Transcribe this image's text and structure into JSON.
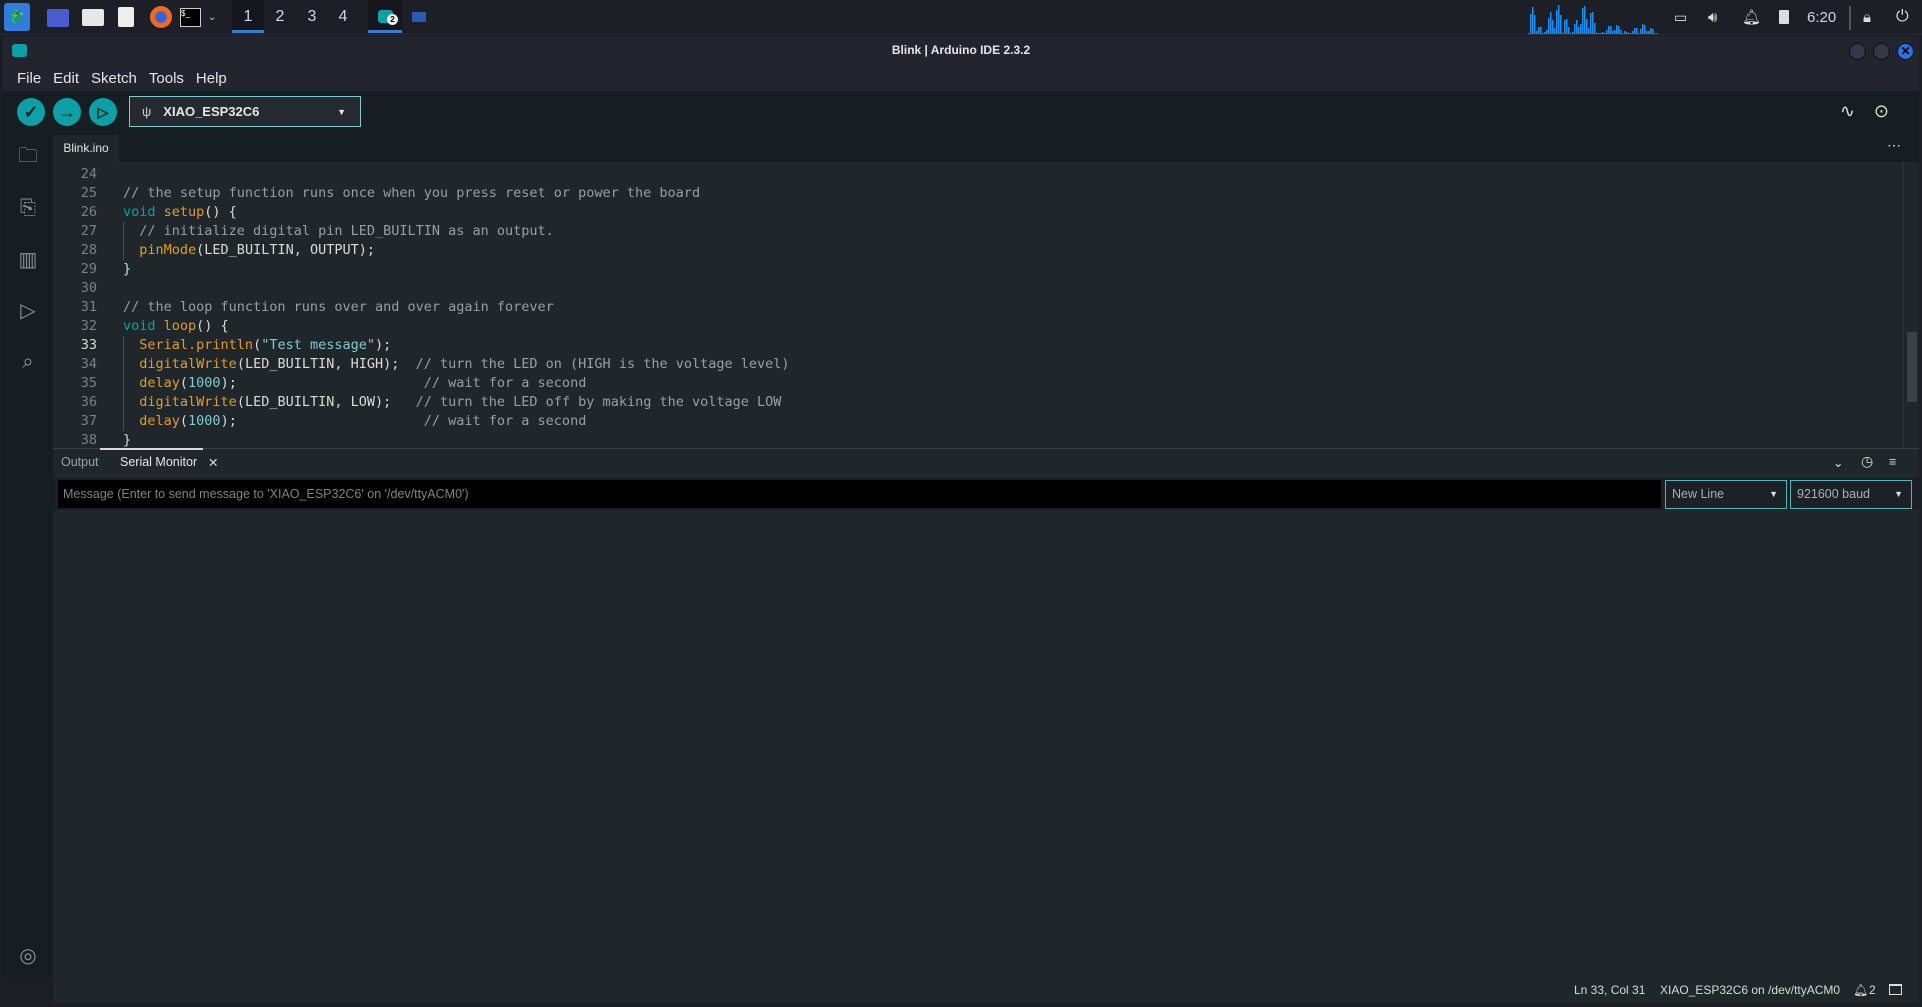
{
  "taskbar": {
    "workspaces": [
      "1",
      "2",
      "3",
      "4"
    ],
    "active_workspace": "1",
    "app_badge": "2",
    "clock": "6:20"
  },
  "window": {
    "title": "Blink | Arduino IDE 2.3.2"
  },
  "menu": [
    "File",
    "Edit",
    "Sketch",
    "Tools",
    "Help"
  ],
  "toolbar": {
    "board": "XIAO_ESP32C6"
  },
  "editor": {
    "tab": "Blink.ino",
    "current_line": "33",
    "lines": [
      {
        "n": "24",
        "s": []
      },
      {
        "n": "25",
        "s": [
          [
            "cm",
            "// the setup function runs once when you press reset or power the board"
          ]
        ]
      },
      {
        "n": "26",
        "s": [
          [
            "kw",
            "void "
          ],
          [
            "fn",
            "setup"
          ],
          [
            "pl",
            "() {"
          ]
        ]
      },
      {
        "n": "27",
        "s": [
          [
            "pl",
            "  "
          ],
          [
            "cm",
            "// initialize digital pin LED_BUILTIN as an output."
          ]
        ]
      },
      {
        "n": "28",
        "s": [
          [
            "pl",
            "  "
          ],
          [
            "fn",
            "pinMode"
          ],
          [
            "pl",
            "(LED_BUILTIN, OUTPUT);"
          ]
        ]
      },
      {
        "n": "29",
        "s": [
          [
            "pl",
            "}"
          ]
        ]
      },
      {
        "n": "30",
        "s": []
      },
      {
        "n": "31",
        "s": [
          [
            "cm",
            "// the loop function runs over and over again forever"
          ]
        ]
      },
      {
        "n": "32",
        "s": [
          [
            "kw",
            "void "
          ],
          [
            "fn",
            "loop"
          ],
          [
            "pl",
            "() {"
          ]
        ]
      },
      {
        "n": "33",
        "s": [
          [
            "pl",
            "  "
          ],
          [
            "fn",
            "Serial.println"
          ],
          [
            "pl",
            "("
          ],
          [
            "str",
            "\"Test message\""
          ],
          [
            "pl",
            ");"
          ]
        ]
      },
      {
        "n": "34",
        "s": [
          [
            "pl",
            "  "
          ],
          [
            "fn",
            "digitalWrite"
          ],
          [
            "pl",
            "(LED_BUILTIN, HIGH);  "
          ],
          [
            "cm",
            "// turn the LED on (HIGH is the voltage level)"
          ]
        ]
      },
      {
        "n": "35",
        "s": [
          [
            "pl",
            "  "
          ],
          [
            "fn",
            "delay"
          ],
          [
            "pl",
            "("
          ],
          [
            "num",
            "1000"
          ],
          [
            "pl",
            ");                       "
          ],
          [
            "cm",
            "// wait for a second"
          ]
        ]
      },
      {
        "n": "36",
        "s": [
          [
            "pl",
            "  "
          ],
          [
            "fn",
            "digitalWrite"
          ],
          [
            "pl",
            "(LED_BUILTIN, LOW);   "
          ],
          [
            "cm",
            "// turn the LED off by making the voltage LOW"
          ]
        ]
      },
      {
        "n": "37",
        "s": [
          [
            "pl",
            "  "
          ],
          [
            "fn",
            "delay"
          ],
          [
            "pl",
            "("
          ],
          [
            "num",
            "1000"
          ],
          [
            "pl",
            ");                       "
          ],
          [
            "cm",
            "// wait for a second"
          ]
        ]
      },
      {
        "n": "38",
        "s": [
          [
            "pl",
            "}"
          ]
        ]
      }
    ]
  },
  "panel": {
    "tabs": [
      "Output",
      "Serial Monitor"
    ],
    "active_tab": "Serial Monitor",
    "message_placeholder": "Message (Enter to send message to 'XIAO_ESP32C6' on '/dev/ttyACM0')",
    "line_ending": "New Line",
    "baud": "921600 baud"
  },
  "status": {
    "position": "Ln 33, Col 31",
    "board_port": "XIAO_ESP32C6 on /dev/ttyACM0",
    "notifications": "2"
  },
  "colors": {
    "accent": "#0ca1a6",
    "keyword": "#0ca1a6",
    "function": "#e39b2b",
    "comment": "#95a0a6",
    "number": "#7fcbcd"
  }
}
